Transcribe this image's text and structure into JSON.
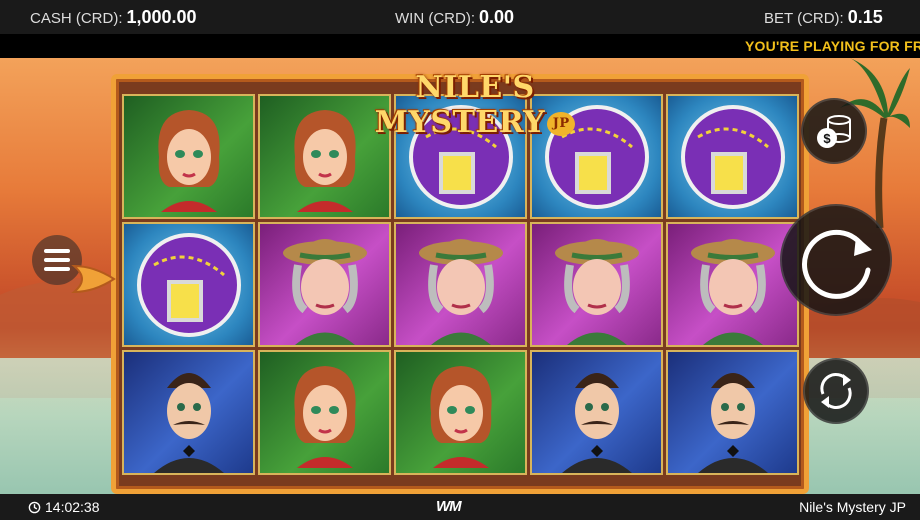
{
  "topbar": {
    "cash_label": "CASH (CRD):",
    "cash_value": "1,000.00",
    "win_label": "WIN (CRD):",
    "win_value": "0.00",
    "bet_label": "BET (CRD):",
    "bet_value": "0.15"
  },
  "ticker": {
    "text": "YOU'RE PLAYING FOR FRE"
  },
  "game": {
    "logo_text": "NILE'S MYSTERY",
    "logo_badge": "JP",
    "reels": [
      [
        "young-lady",
        "gem-necklace",
        "gentleman"
      ],
      [
        "young-lady",
        "older-lady",
        "young-lady"
      ],
      [
        "gem-necklace",
        "older-lady",
        "young-lady"
      ],
      [
        "gem-necklace",
        "older-lady",
        "gentleman"
      ],
      [
        "gem-necklace",
        "older-lady",
        "gentleman"
      ]
    ]
  },
  "controls": {
    "menu_icon": "hamburger-icon",
    "bet_icon": "coin-stack-icon",
    "spin_icon": "spin-arrow-icon",
    "autoplay_icon": "autoplay-icon"
  },
  "bottombar": {
    "clock": "14:02:38",
    "brand": "WM",
    "game_name": "Nile's Mystery JP"
  },
  "colors": {
    "ticker": "#f2c01b",
    "frame": "#f0a137",
    "young_lady_bg": "#47a13a",
    "gem_bg": "#2d86bf",
    "older_lady_bg": "#c64fc6",
    "gentleman_bg": "#3c66c9"
  }
}
